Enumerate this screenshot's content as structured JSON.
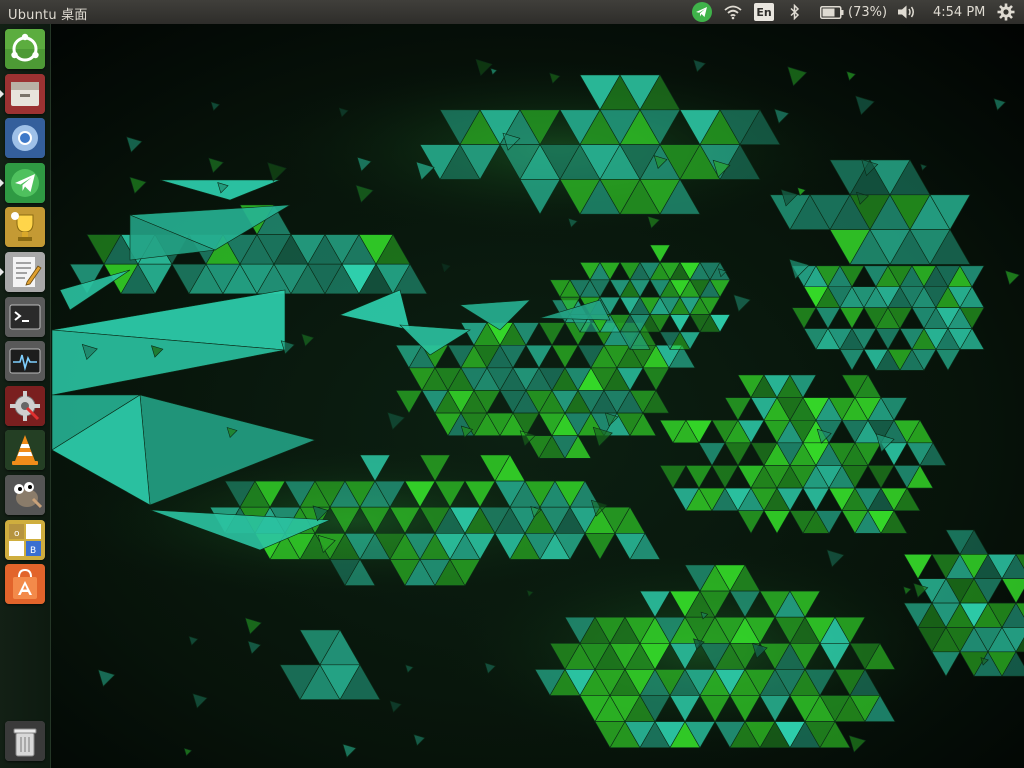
{
  "panel": {
    "title": "Ubuntu 桌面",
    "indicators": {
      "telegram_icon": "telegram-tray-icon",
      "wifi_icon": "wifi-icon",
      "keyboard_layout": "En",
      "bluetooth_icon": "bluetooth-icon",
      "battery_text": "(73%)",
      "battery_level": 0.73,
      "sound_icon": "speaker-icon",
      "clock": "4:54 PM",
      "session_icon": "gear-icon"
    }
  },
  "launcher": {
    "items": [
      {
        "name": "dash-home",
        "icon": "ubuntu-logo-icon",
        "color": "#5fae3c"
      },
      {
        "name": "files",
        "icon": "file-cabinet-icon",
        "color": "#a33a3a",
        "running": true
      },
      {
        "name": "chromium",
        "icon": "chromium-icon",
        "color": "#3d6fb8"
      },
      {
        "name": "telegram",
        "icon": "telegram-icon",
        "color": "#3aa84e",
        "running": true
      },
      {
        "name": "winner-app",
        "icon": "trophy-icon",
        "color": "#caa23a"
      },
      {
        "name": "text-editor",
        "icon": "text-editor-icon",
        "color": "#b8b8b8",
        "running": true
      },
      {
        "name": "terminal",
        "icon": "terminal-icon",
        "color": "#3b3b3b"
      },
      {
        "name": "system-monitor",
        "icon": "system-monitor-icon",
        "color": "#4a4a4a"
      },
      {
        "name": "system-settings",
        "icon": "settings-gear-icon",
        "color": "#7a1f1f"
      },
      {
        "name": "vlc",
        "icon": "vlc-cone-icon",
        "color": "#2a4a2a"
      },
      {
        "name": "gimp",
        "icon": "gimp-icon",
        "color": "#555555"
      },
      {
        "name": "libreoffice-base",
        "icon": "office-grid-icon",
        "color": "#cfae3e"
      },
      {
        "name": "software-center",
        "icon": "software-center-bag-icon",
        "color": "#e2642b"
      }
    ],
    "trash": {
      "name": "trash",
      "icon": "trash-icon"
    }
  },
  "wallpaper": {
    "description_icon": "green-triangle-mosaic-wallpaper",
    "colors": {
      "teal": "#2fd3b0",
      "green": "#38e62a",
      "dark": "#030805"
    }
  }
}
